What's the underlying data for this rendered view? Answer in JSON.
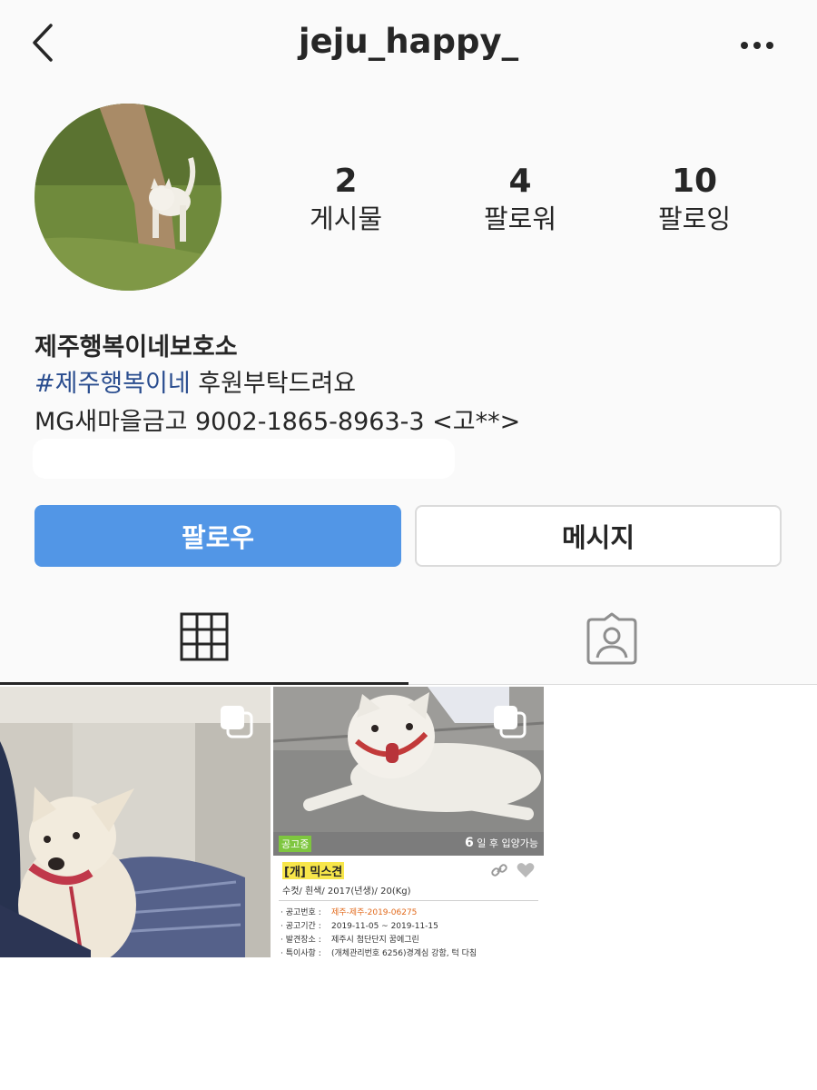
{
  "header": {
    "username": "jeju_happy_",
    "back_icon": "chevron-left-icon",
    "more_icon": "more-horizontal-icon"
  },
  "profile": {
    "avatar_icon": "dog-avatar",
    "stats": [
      {
        "value": "2",
        "label": "게시물"
      },
      {
        "value": "4",
        "label": "팔로워"
      },
      {
        "value": "10",
        "label": "팔로잉"
      }
    ],
    "bio": {
      "name": "제주행복이네보호소",
      "hashtag": "#제주행복이네",
      "line1_rest": " 후원부탁드려요",
      "line2": "MG새마을금고 9002-1865-8963-3 <고**>"
    }
  },
  "actions": {
    "follow_label": "팔로우",
    "message_label": "메시지"
  },
  "tabs": [
    {
      "icon": "grid-icon",
      "active": true
    },
    {
      "icon": "tagged-person-icon",
      "active": false
    }
  ],
  "posts": [
    {
      "kind": "photo",
      "multi": true
    },
    {
      "kind": "adoption-card",
      "multi": true,
      "card": {
        "status": "공고중",
        "avail_num": "6",
        "avail_text": " 일 후 입양가능",
        "title": "[개] 믹스견",
        "subtitle": "수컷/ 흰색/ 2017(년생)/ 20(Kg)",
        "details": [
          {
            "key": "· 공고번호 :",
            "value": "제주-제주-2019-06275"
          },
          {
            "key": "· 공고기간 :",
            "value": "2019-11-05 ~ 2019-11-15"
          },
          {
            "key": "· 발견장소 :",
            "value": "제주시 첨단단지 꿈에그린"
          },
          {
            "key": "· 특이사항 :",
            "value": "(개체관리번호 6256)경계심 강함, 턱 다침"
          }
        ]
      }
    }
  ],
  "colors": {
    "follow_blue": "#5296e6",
    "hashtag_blue": "#2a4d8f",
    "status_green": "#7ec63f",
    "notice_orange": "#e26a1c"
  }
}
